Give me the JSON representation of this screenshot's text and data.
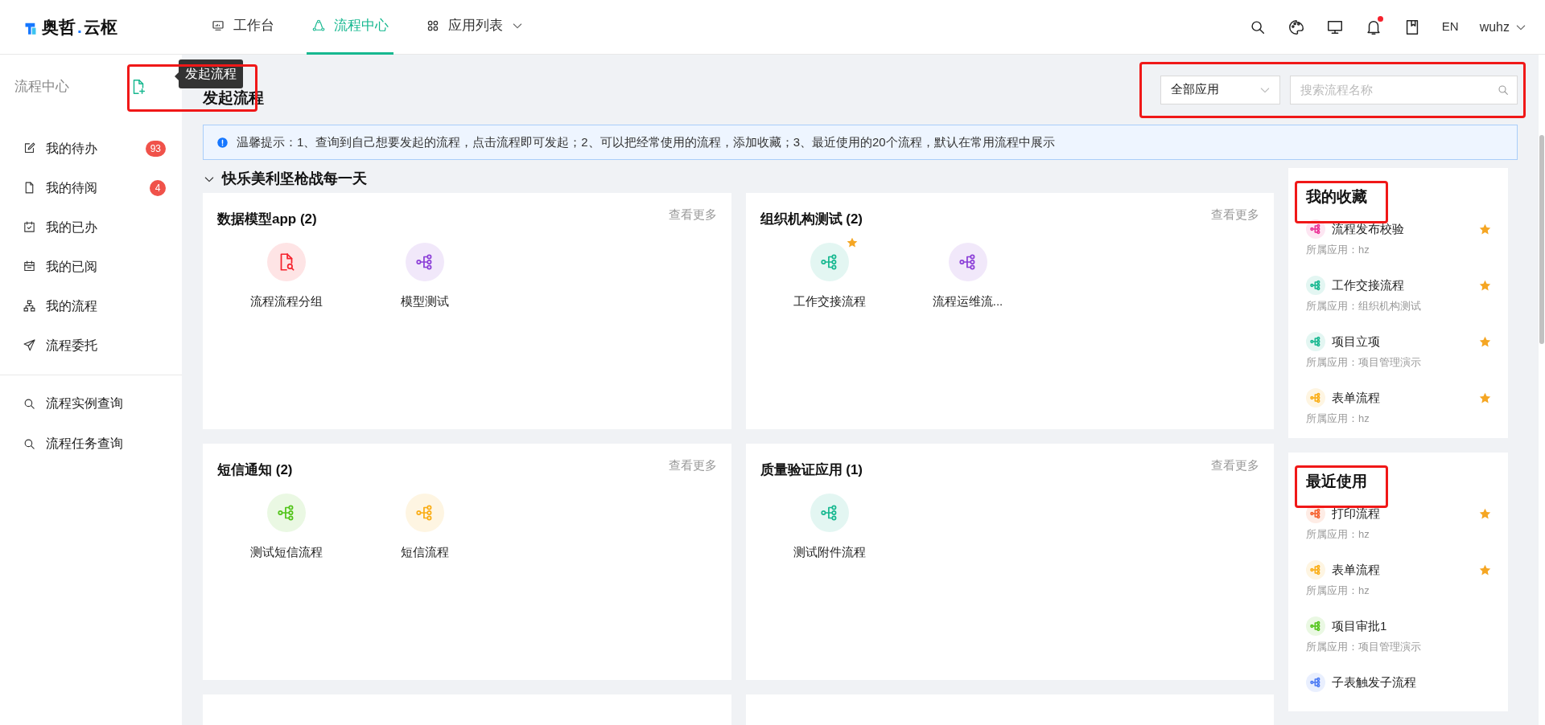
{
  "header": {
    "logo": {
      "left": "奥哲",
      "dot": ".",
      "right": "云枢"
    },
    "nav": [
      {
        "label": "工作台",
        "selected": false,
        "dropdown": false
      },
      {
        "label": "流程中心",
        "selected": true,
        "dropdown": false
      },
      {
        "label": "应用列表",
        "selected": false,
        "dropdown": true
      }
    ],
    "notification_dot": true,
    "language": "EN",
    "user": "wuhz"
  },
  "sidebar": {
    "title": "流程中心",
    "new_button": {
      "tooltip": "发起流程",
      "annotated": true
    },
    "menu": [
      {
        "label": "我的待办",
        "badge": "93"
      },
      {
        "label": "我的待阅",
        "badge": "4"
      },
      {
        "label": "我的已办"
      },
      {
        "label": "我的已阅"
      },
      {
        "label": "我的流程"
      },
      {
        "label": "流程委托"
      }
    ],
    "queries": [
      {
        "label": "流程实例查询"
      },
      {
        "label": "流程任务查询"
      }
    ]
  },
  "page": {
    "title": "发起流程",
    "filter": {
      "annotated": true,
      "select": "全部应用",
      "placeholder": "搜索流程名称"
    },
    "notice": "温馨提示：1、查询到自己想要发起的流程，点击流程即可发起；2、可以把经常使用的流程，添加收藏；3、最近使用的20个流程，默认在常用流程中展示",
    "group": {
      "title": "快乐美利坚枪战每一天",
      "expanded": true,
      "apps": [
        {
          "title": "数据模型app (2)",
          "more": "查看更多",
          "flows": [
            {
              "name": "流程流程分组",
              "kind": "document",
              "color": "#f5222d",
              "starred": false
            },
            {
              "name": "模型测试",
              "kind": "flow",
              "color": "#8c3fd8",
              "starred": false
            }
          ]
        },
        {
          "title": "组织机构测试 (2)",
          "more": "查看更多",
          "flows": [
            {
              "name": "工作交接流程",
              "kind": "flow",
              "color": "#17b890",
              "starred": true
            },
            {
              "name": "流程运维流...",
              "kind": "flow",
              "color": "#8c3fd8",
              "starred": false
            }
          ]
        },
        {
          "title": "短信通知 (2)",
          "more": "查看更多",
          "flows": [
            {
              "name": "测试短信流程",
              "kind": "flow",
              "color": "#52c41a",
              "starred": false
            },
            {
              "name": "短信流程",
              "kind": "flow",
              "color": "#faad14",
              "starred": false
            }
          ]
        },
        {
          "title": "质量验证应用 (1)",
          "more": "查看更多",
          "flows": [
            {
              "name": "测试附件流程",
              "kind": "flow",
              "color": "#17b890",
              "starred": false
            }
          ]
        }
      ]
    }
  },
  "panels": [
    {
      "title": "我的收藏",
      "annotated": true,
      "items": [
        {
          "name": "流程发布校验",
          "app": "所属应用：hz",
          "color": "#eb2f96",
          "starred": true
        },
        {
          "name": "工作交接流程",
          "app": "所属应用：组织机构测试",
          "color": "#17b890",
          "starred": true
        },
        {
          "name": "项目立项",
          "app": "所属应用：项目管理演示",
          "color": "#17b890",
          "starred": true
        },
        {
          "name": "表单流程",
          "app": "所属应用：hz",
          "color": "#faad14",
          "starred": true
        }
      ]
    },
    {
      "title": "最近使用",
      "annotated": true,
      "items": [
        {
          "name": "打印流程",
          "app": "所属应用：hz",
          "color": "#f5602d",
          "starred": true
        },
        {
          "name": "表单流程",
          "app": "所属应用：hz",
          "color": "#faad14",
          "starred": true
        },
        {
          "name": "项目审批1",
          "app": "所属应用：项目管理演示",
          "color": "#52c41a",
          "starred": false
        },
        {
          "name": "子表触发子流程",
          "color": "#4c7bf4",
          "starred": false
        }
      ]
    }
  ]
}
